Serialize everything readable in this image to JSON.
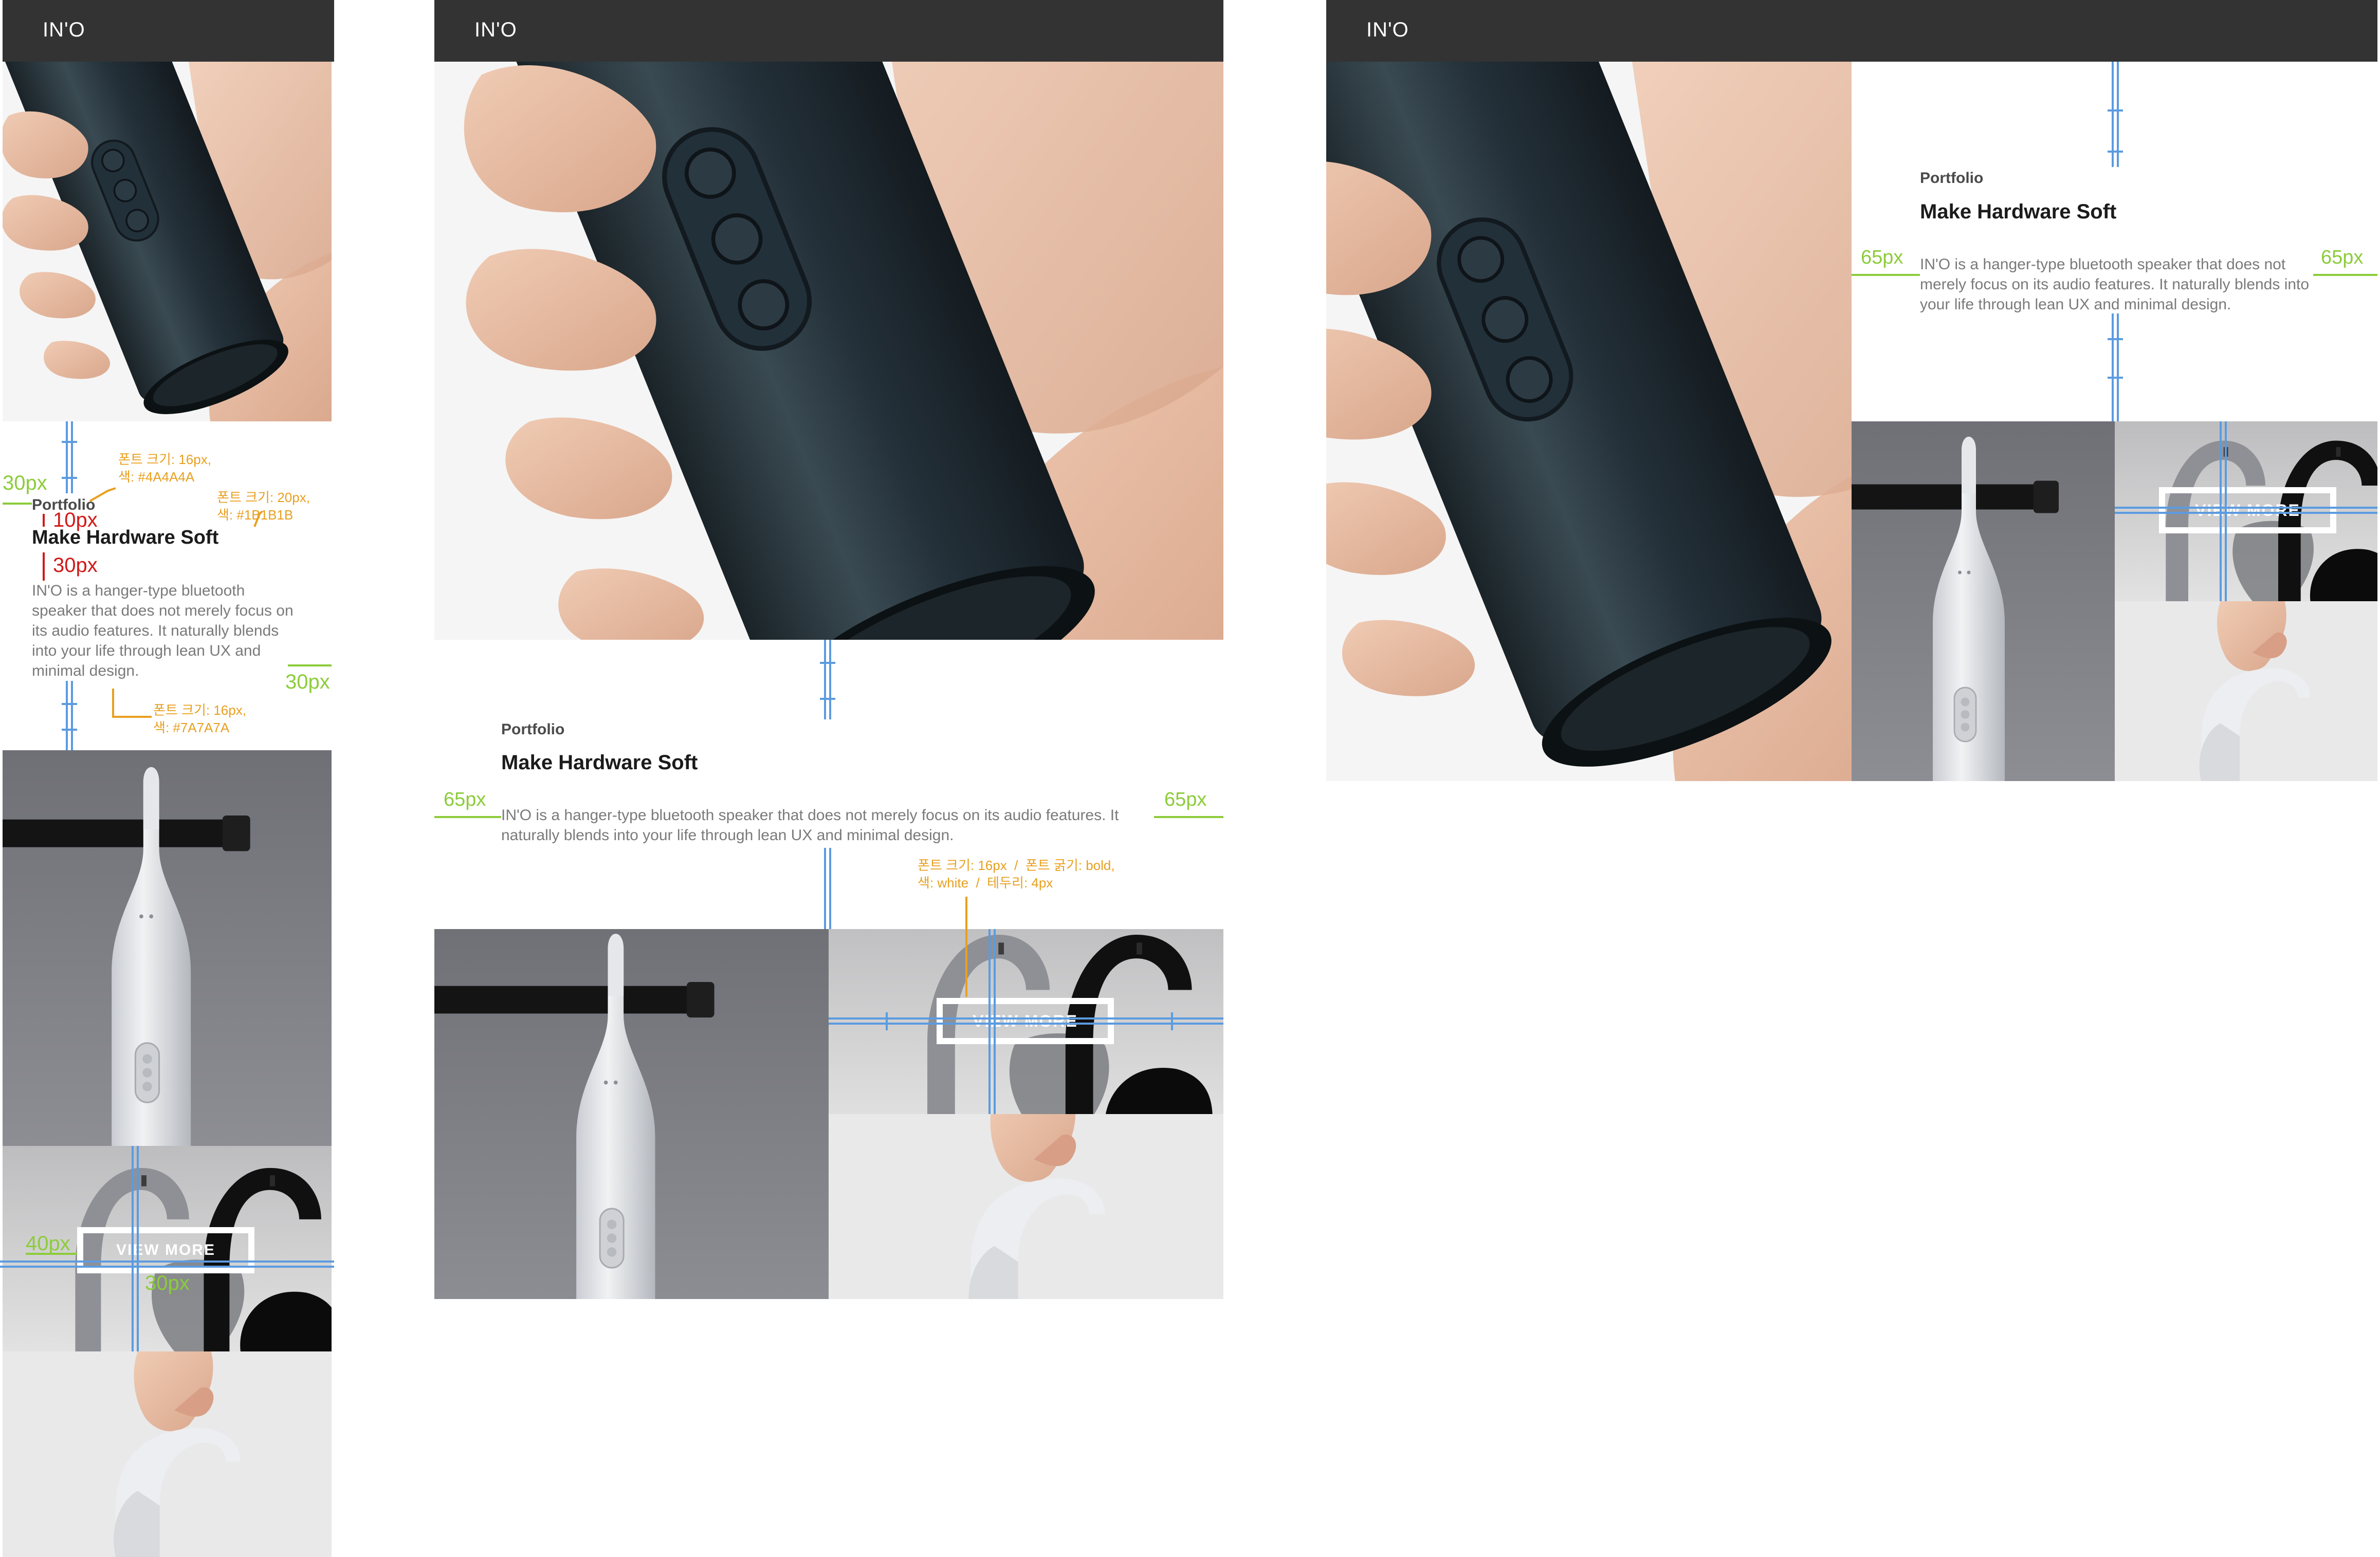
{
  "brand": {
    "logo_text": "IN'O"
  },
  "section": {
    "category": "Portfolio",
    "title": "Make Hardware Soft",
    "description": "IN'O is a hanger-type bluetooth speaker that does not merely focus on its audio features. It naturally blends into your life through lean UX and minimal design.",
    "view_more_label": "VIEW MORE"
  },
  "annotations": {
    "spacing_30px": "30px",
    "spacing_10px": "10px",
    "spacing_65px": "65px",
    "spacing_40px": "40px",
    "category_font": "폰트 크기: 16px,\n색: #4A4A4A",
    "title_font": "폰트 크기: 20px,\n색: #1B1B1B",
    "desc_font": "폰트 크기: 16px,\n색: #7A7A7A",
    "button_font": "폰트 크기: 16px  /  폰트 굵기: bold,\n색: white  /  테두리: 4px"
  },
  "colors": {
    "header_bg": "#333333",
    "category": "#4A4A4A",
    "title": "#1B1B1B",
    "description": "#7A7A7A",
    "annotation_green": "#8CCC3A",
    "annotation_orange": "#E8A020",
    "annotation_red": "#D11A1A",
    "guide_blue": "#5B9BE0"
  },
  "icons": {
    "hero": "speaker-held-in-hand-photo",
    "hanging": "speaker-hanging-on-bar-photo",
    "hooks": "speaker-hooks-photo",
    "hand": "hand-holding-hook-photo"
  }
}
